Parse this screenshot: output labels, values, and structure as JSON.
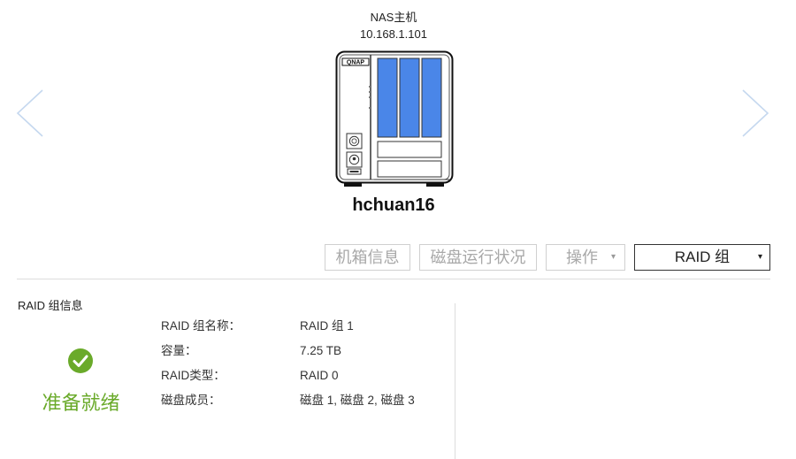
{
  "device": {
    "title": "NAS主机",
    "ip": "10.168.1.101",
    "brand": "QNAP",
    "hostname": "hchuan16"
  },
  "toolbar": {
    "chassis_info": "机箱信息",
    "disk_status": "磁盘运行状况",
    "operate": "操作",
    "raid_select": "RAID 组",
    "caret": "▾"
  },
  "raid_info": {
    "section_title": "RAID 组信息",
    "status": "准备就绪",
    "rows": [
      {
        "label": "RAID 组名称：",
        "value": "RAID 组 1"
      },
      {
        "label": "容量：",
        "value": "7.25 TB"
      },
      {
        "label": "RAID类型：",
        "value": "RAID 0"
      },
      {
        "label": "磁盘成员：",
        "value": "磁盘 1, 磁盘 2, 磁盘 3"
      }
    ]
  },
  "colors": {
    "drive_bay": "#4a86e8",
    "status_ok": "#6aaa2a",
    "nav_arrow": "#c5d8ef"
  }
}
